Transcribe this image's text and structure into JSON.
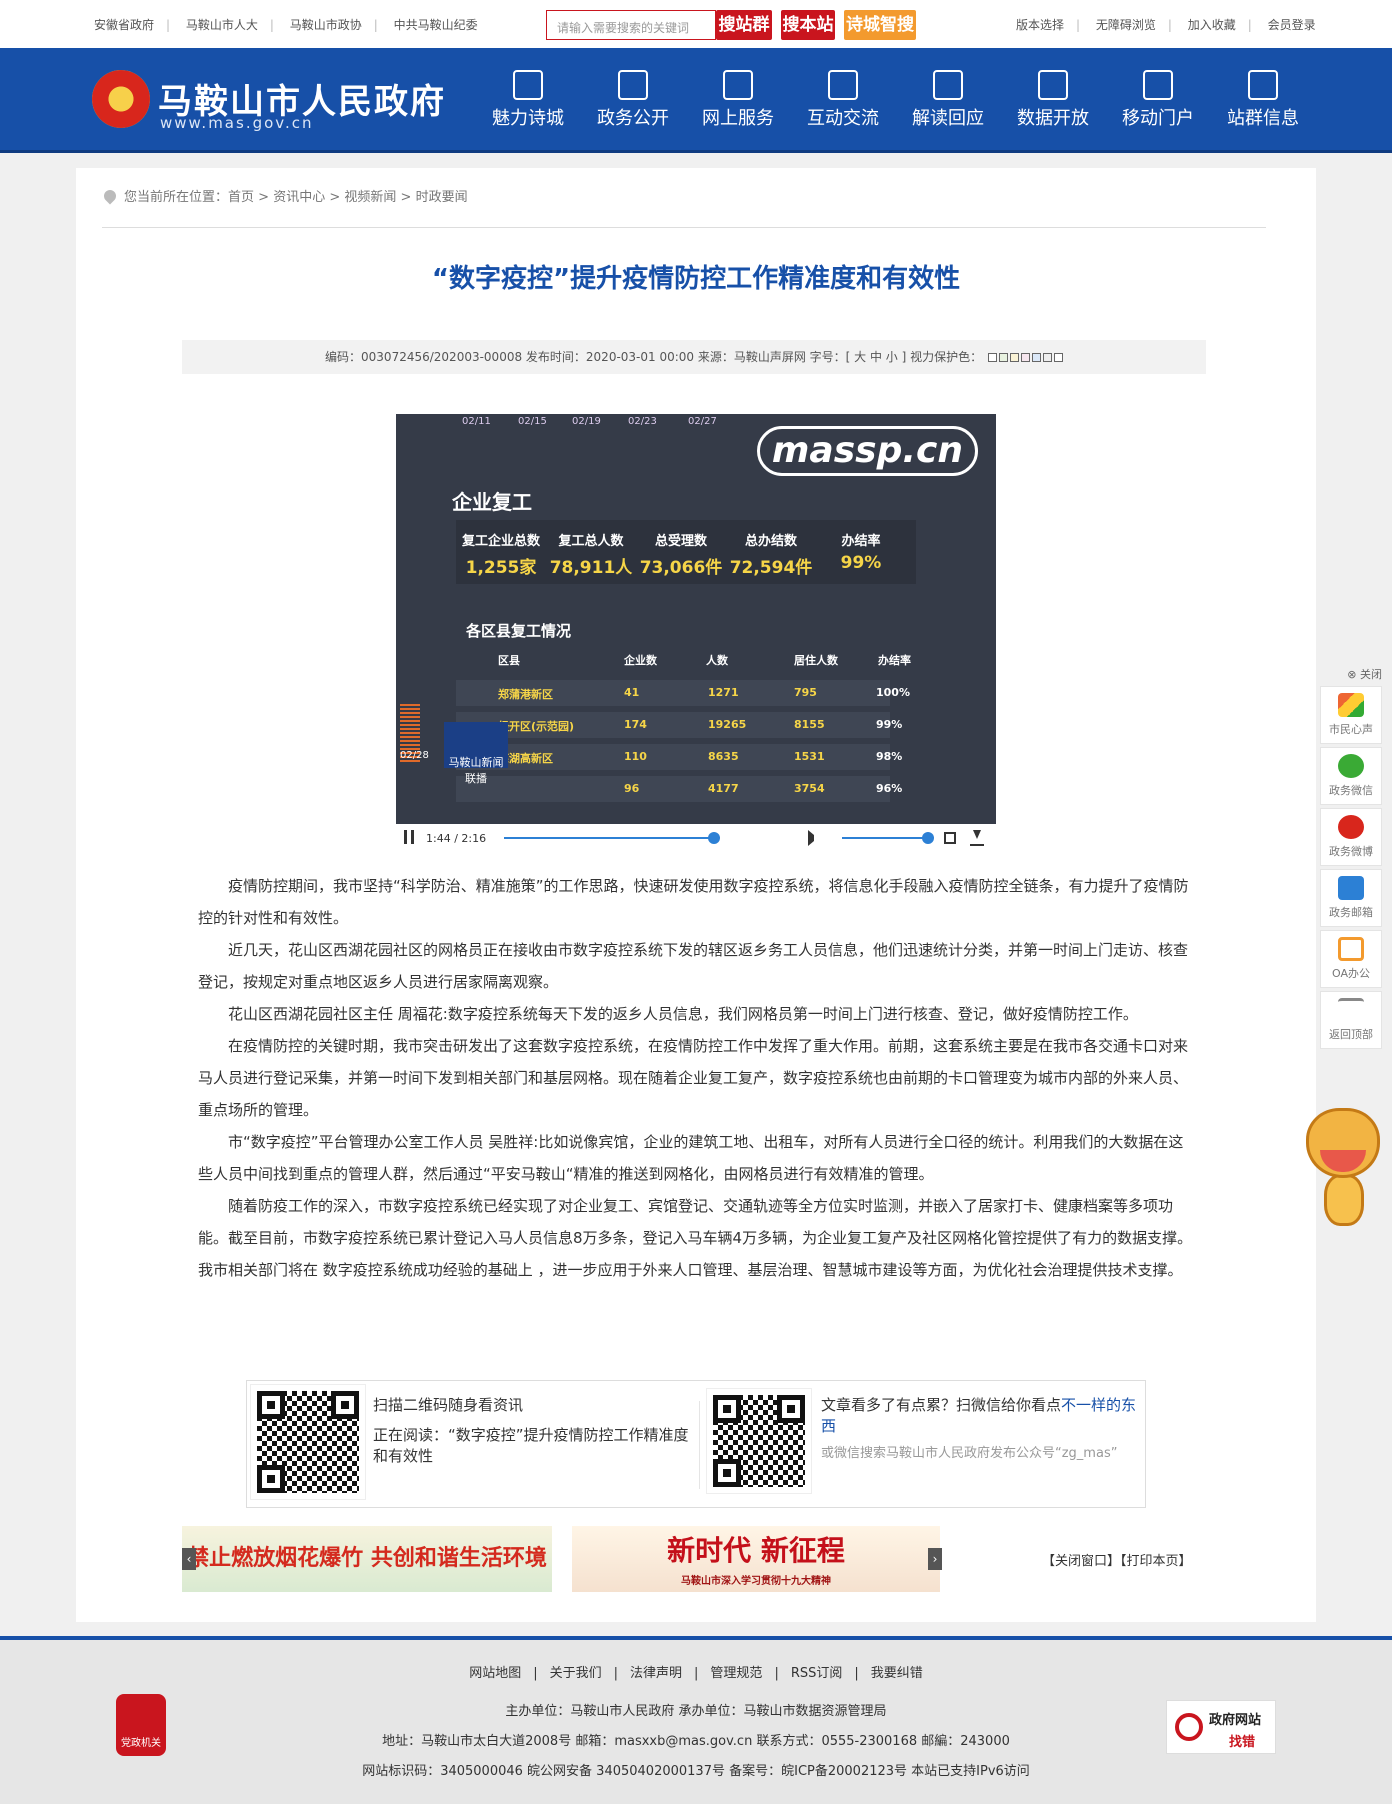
{
  "topbar": {
    "links": [
      "安徽省政府",
      "马鞍山市人大",
      "马鞍山市政协",
      "中共马鞍山纪委"
    ],
    "search_placeholder": "请输入需要搜索的关键词",
    "search_buttons": [
      "搜站群",
      "搜本站",
      "诗城智搜"
    ],
    "right_links": [
      "版本选择",
      "无障碍浏览",
      "加入收藏",
      "会员登录"
    ]
  },
  "header": {
    "title": "马鞍山市人民政府",
    "url": "www.mas.gov.cn",
    "nav": [
      "魅力诗城",
      "政务公开",
      "网上服务",
      "互动交流",
      "解读回应",
      "数据开放",
      "移动门户",
      "站群信息"
    ]
  },
  "breadcrumb": {
    "prefix": "您当前所在位置：",
    "items": [
      "首页",
      "资讯中心",
      "视频新闻",
      "时政要闻"
    ]
  },
  "article": {
    "title": "“数字疫控”提升疫情防控工作精准度和有效性",
    "meta": "编码：003072456/202003-00008   发布时间：2020-03-01 00:00  来源：马鞍山声屏网  字号：[ 大  中  小 ]  视力保护色：",
    "paragraphs": [
      "疫情防控期间，我市坚持“科学防治、精准施策”的工作思路，快速研发使用数字疫控系统，将信息化手段融入疫情防控全链条，有力提升了疫情防控的针对性和有效性。",
      "近几天，花山区西湖花园社区的网格员正在接收由市数字疫控系统下发的辖区返乡务工人员信息，他们迅速统计分类，并第一时间上门走访、核查登记，按规定对重点地区返乡人员进行居家隔离观察。",
      "花山区西湖花园社区主任 周福花:数字疫控系统每天下发的返乡人员信息，我们网格员第一时间上门进行核查、登记，做好疫情防控工作。",
      "在疫情防控的关键时期，我市突击研发出了这套数字疫控系统，在疫情防控工作中发挥了重大作用。前期，这套系统主要是在我市各交通卡口对来马人员进行登记采集，并第一时间下发到相关部门和基层网格。现在随着企业复工复产，数字疫控系统也由前期的卡口管理变为城市内部的外来人员、重点场所的管理。",
      "市“数字疫控”平台管理办公室工作人员 吴胜祥:比如说像宾馆，企业的建筑工地、出租车，对所有人员进行全口径的统计。利用我们的大数据在这些人员中间找到重点的管理人群，然后通过“平安马鞍山“精准的推送到网格化，由网格员进行有效精准的管理。",
      "随着防疫工作的深入，市数字疫控系统已经实现了对企业复工、宾馆登记、交通轨迹等全方位实时监测，并嵌入了居家打卡、健康档案等多项功能。截至目前，市数字疫控系统已累计登记入马人员信息8万多条，登记入马车辆4万多辆，为企业复工复产及社区网格化管控提供了有力的数据支撑。 我市相关部门将在 数字疫控系统成功经验的基础上 ，进一步应用于外来人口管理、基层治理、智慧城市建设等方面，为优化社会治理提供技术支撑。"
    ]
  },
  "video": {
    "dates": [
      "02/11",
      "02/15",
      "02/19",
      "02/23",
      "02/27"
    ],
    "watermark": "massp.cn",
    "section": "企业复工",
    "stats": [
      {
        "label": "复工企业总数",
        "value": "1,255家"
      },
      {
        "label": "复工总人数",
        "value": "78,911人"
      },
      {
        "label": "总受理数",
        "value": "73,066件"
      },
      {
        "label": "总办结数",
        "value": "72,594件"
      },
      {
        "label": "办结率",
        "value": "99%"
      }
    ],
    "subtitle": "各区县复工情况",
    "headers": [
      "区县",
      "企业数",
      "人数",
      "居住人数",
      "办结率"
    ],
    "rows": [
      [
        "郑蒲港新区",
        "41",
        "1271",
        "795",
        "100%"
      ],
      [
        "经开区(示范园)",
        "174",
        "19265",
        "8155",
        "99%"
      ],
      [
        "慈湖高新区",
        "110",
        "8635",
        "1531",
        "98%"
      ],
      [
        "",
        "96",
        "4177",
        "3754",
        "96%"
      ]
    ],
    "side_date": "02/28",
    "news_logo": "马鞍山新闻联播",
    "time": "1:44 / 2:16",
    "progress": 0.82,
    "volume": 1.0
  },
  "qr": {
    "left_title": "扫描二维码随身看资讯",
    "left_reading": "正在阅读：“数字疫控”提升疫情防控工作精准度和有效性",
    "right_title_a": "文章看多了有点累？扫微信给你看点",
    "right_title_b": "不一样的东西",
    "right_sub": "或微信搜索马鞍山市人民政府发布公众号“zg_mas”"
  },
  "banners": {
    "left": "禁止燃放烟花爆竹 共创和谐生活环境",
    "right": "新时代 新征程",
    "right_sub": "马鞍山市深入学习贯彻十九大精神"
  },
  "actions": {
    "close": "【关闭窗口】",
    "print": "【打印本页】"
  },
  "sidebar": {
    "close": "关闭",
    "items": [
      "市民心声",
      "政务微信",
      "政务微博",
      "政务邮箱",
      "OA办公",
      "返回顶部"
    ]
  },
  "footer": {
    "links": [
      "网站地图",
      "关于我们",
      "法律声明",
      "管理规范",
      "RSS订阅",
      "我要纠错"
    ],
    "sponsor": "主办单位：马鞍山市人民政府    承办单位：马鞍山市数据资源管理局",
    "address": "地址：马鞍山市太白大道2008号  邮箱：masxxb@mas.gov.cn  联系方式：0555-2300168     邮編：243000",
    "ids": "网站标识码：3405000046       皖公网安备 34050402000137号    备案号：皖ICP备20002123号    本站已支持IPv6访问",
    "badge": "党政机关",
    "right_a": "政府网站",
    "right_b": "找错"
  },
  "colors": {
    "brand": "#1750a8",
    "accent": "#c9151e",
    "orange": "#f39a2e"
  }
}
